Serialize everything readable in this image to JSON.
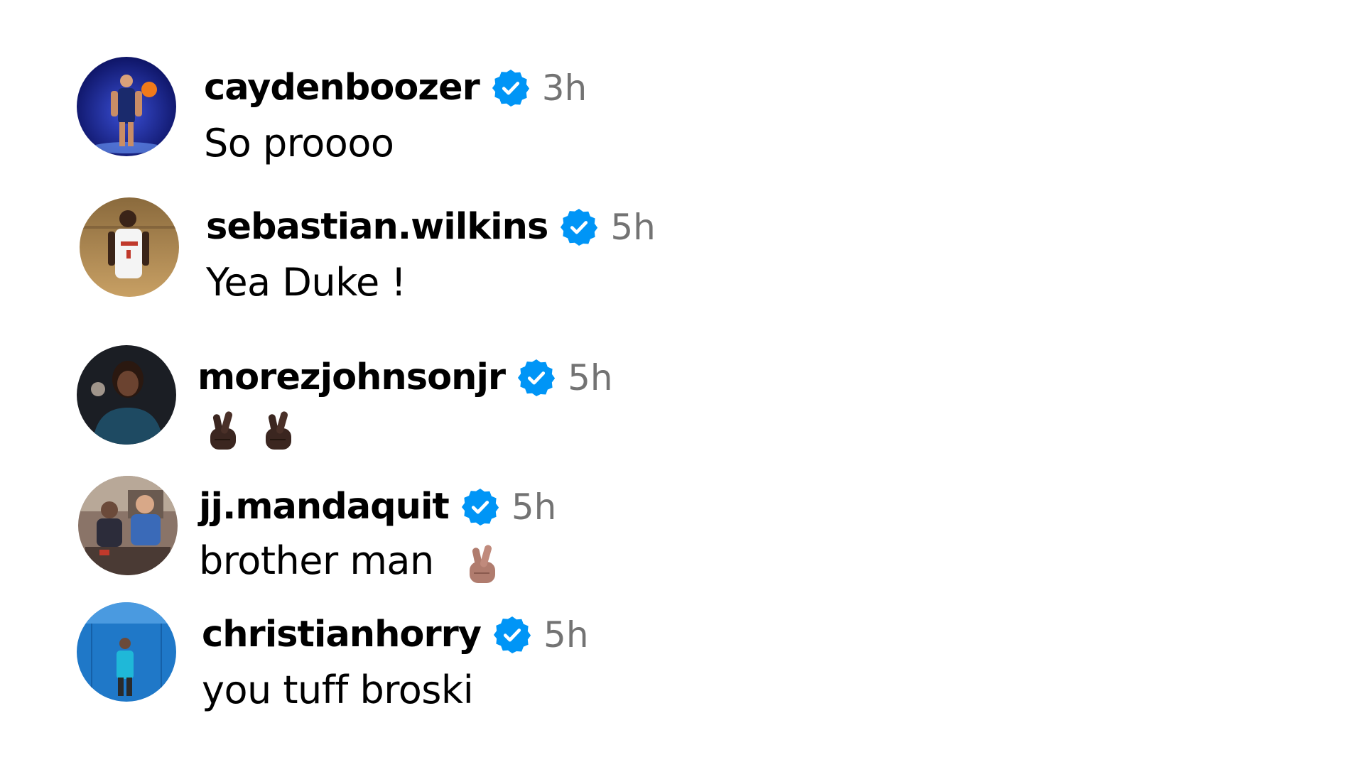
{
  "comments": [
    {
      "username": "caydenboozer",
      "time": "3h",
      "text": "So proooo",
      "avatar_icon": "avatar-basketball-player-blue"
    },
    {
      "username": "sebastian.wilkins",
      "time": "5h",
      "text": "Yea Duke !",
      "avatar_icon": "avatar-basketball-player-gym"
    },
    {
      "username": "morezjohnsonjr",
      "time": "5h",
      "text": "",
      "emojis": [
        "crossed-fingers-dark-skin-emoji",
        "crossed-fingers-dark-skin-emoji"
      ],
      "avatar_icon": "avatar-portrait-dark"
    },
    {
      "username": "jj.mandaquit",
      "time": "5h",
      "text": "brother man",
      "emojis": [
        "crossed-fingers-medium-skin-emoji"
      ],
      "avatar_icon": "avatar-group-photo"
    },
    {
      "username": "christianhorry",
      "time": "5h",
      "text": "you tuff broski",
      "avatar_icon": "avatar-basketball-player-court"
    }
  ],
  "colors": {
    "verified_badge": "#0095F6",
    "timestamp": "#737373",
    "text": "#000000",
    "dark_skin": "#3b2620",
    "medium_skin": "#b07c6e"
  }
}
